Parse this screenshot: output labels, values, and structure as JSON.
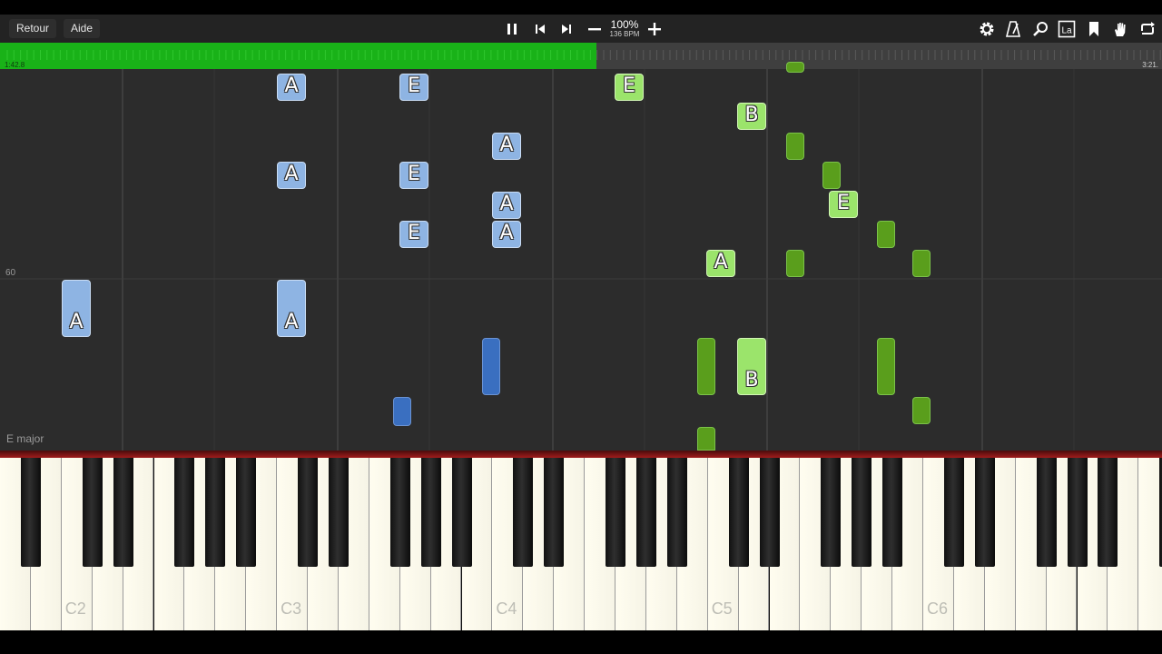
{
  "toolbar": {
    "back_label": "Retour",
    "help_label": "Aide",
    "zoom": "100%",
    "bpm": "136 BPM",
    "icons": [
      "pause-icon",
      "skip-back-icon",
      "skip-forward-icon",
      "minus-icon",
      "plus-icon",
      "gear-icon",
      "metronome-icon",
      "magnifier-icon",
      "note-label-icon",
      "bookmark-icon",
      "hand-icon",
      "loop-icon"
    ]
  },
  "progress": {
    "current": "1:42.8",
    "total": "3:21.",
    "fraction": 0.513
  },
  "roll": {
    "pitch_label": "60",
    "key_label": "E major"
  },
  "notes": [
    {
      "letter": "A",
      "hand": "left",
      "active": false
    },
    {
      "letter": "A",
      "hand": "left",
      "active": false
    },
    {
      "letter": "A",
      "hand": "left",
      "active": false
    },
    {
      "letter": "A",
      "hand": "left",
      "active": false
    },
    {
      "letter": "E",
      "hand": "left",
      "active": false
    },
    {
      "letter": "E",
      "hand": "left",
      "active": false
    },
    {
      "letter": "E",
      "hand": "left",
      "active": false
    },
    {
      "letter": "A",
      "hand": "left",
      "active": false
    },
    {
      "letter": "A",
      "hand": "left",
      "active": false
    },
    {
      "letter": "A",
      "hand": "left",
      "active": false
    },
    {
      "letter": "",
      "hand": "left",
      "active": false
    },
    {
      "letter": "",
      "hand": "left",
      "active": false
    },
    {
      "letter": "E",
      "hand": "right",
      "active": false
    },
    {
      "letter": "B",
      "hand": "right",
      "active": false
    },
    {
      "letter": "E",
      "hand": "right",
      "active": false
    },
    {
      "letter": "A",
      "hand": "right",
      "active": false
    },
    {
      "letter": "B",
      "hand": "right",
      "active": false
    },
    {
      "letter": "",
      "hand": "right",
      "active": false
    },
    {
      "letter": "",
      "hand": "right",
      "active": false
    },
    {
      "letter": "",
      "hand": "right",
      "active": false
    },
    {
      "letter": "",
      "hand": "right",
      "active": false
    },
    {
      "letter": "",
      "hand": "right",
      "active": false
    },
    {
      "letter": "",
      "hand": "right",
      "active": false
    },
    {
      "letter": "",
      "hand": "right",
      "active": false
    },
    {
      "letter": "",
      "hand": "right",
      "active": false
    },
    {
      "letter": "",
      "hand": "right",
      "active": false
    },
    {
      "letter": "",
      "hand": "right",
      "active": true
    }
  ],
  "keyboard": {
    "octave_labels": [
      "C2",
      "C3",
      "C4",
      "C5",
      "C6"
    ]
  },
  "colors": {
    "left_hand": "#8eb4e3",
    "left_hand_dark": "#3a6fc0",
    "right_hand_light": "#9be46b",
    "right_hand_dark": "#5a9e1c",
    "progress_fill": "#19b218"
  }
}
